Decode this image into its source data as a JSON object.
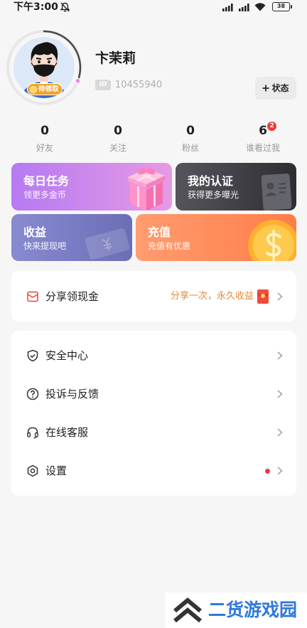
{
  "status_bar": {
    "time": "下午3:00",
    "battery_level": "38",
    "icons": [
      "bell-off-icon",
      "signal-icon",
      "signal-icon",
      "wifi-icon",
      "battery-icon"
    ]
  },
  "profile": {
    "name": "卞茉莉",
    "id_tag": "ID",
    "id_number": "10455940",
    "avatar_badge": "待领取",
    "avatar_ring_progress": 0.31,
    "status_button": "状态"
  },
  "stats": [
    {
      "value": "0",
      "label": "好友"
    },
    {
      "value": "0",
      "label": "关注"
    },
    {
      "value": "0",
      "label": "粉丝"
    },
    {
      "value": "6",
      "label": "谁看过我",
      "badge": "2"
    }
  ],
  "cards": [
    {
      "title": "每日任务",
      "subtitle": "领更多金币",
      "icon": "gift-box-icon",
      "colors": [
        "#b57af2",
        "#e69ae4"
      ]
    },
    {
      "title": "我的认证",
      "subtitle": "获得更多曝光",
      "icon": "id-card-icon",
      "colors": [
        "#55555c",
        "#2d2d32"
      ]
    },
    {
      "title": "收益",
      "subtitle": "快来提现吧",
      "icon": "ticket-icon",
      "colors": [
        "#888bd0",
        "#6b6eb5"
      ]
    },
    {
      "title": "充值",
      "subtitle": "充值有优惠",
      "icon": "coin-icon",
      "colors": [
        "#ff9c70",
        "#ff7d48"
      ]
    }
  ],
  "share": {
    "label": "分享领现金",
    "promo": "分享一次，永久收益",
    "icon": "share-envelope-icon",
    "promo_icon": "red-envelope-icon"
  },
  "menu": [
    {
      "label": "安全中心",
      "icon": "shield-check-icon",
      "red_dot": false
    },
    {
      "label": "投诉与反馈",
      "icon": "question-circle-icon",
      "red_dot": false
    },
    {
      "label": "在线客服",
      "icon": "headset-icon",
      "red_dot": false
    },
    {
      "label": "设置",
      "icon": "settings-icon",
      "red_dot": true
    }
  ],
  "watermark": {
    "text": "二货游戏园"
  },
  "colors": {
    "page_bg": "#f6f6f6",
    "badge_red": "#ee3b3b",
    "promo_orange": "#e3893a",
    "avatar_badge": "#f3a32a",
    "watermark_blue": "#2f78dc"
  }
}
